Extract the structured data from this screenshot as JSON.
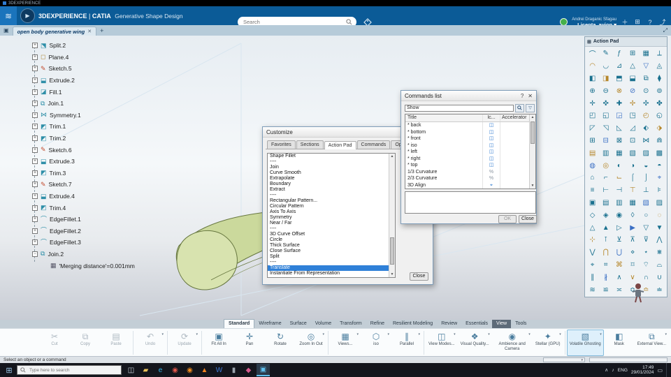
{
  "window": {
    "title": "3DEXPERIENCE"
  },
  "glyphs": {
    "close": "✕",
    "help": "?",
    "plus": "＋",
    "caret": "▾",
    "maximize": "⤢",
    "grid": "⊞",
    "share": "⤴",
    "window": "▣",
    "logo": "≋",
    "play": "▶",
    "new_tab": "+",
    "up": "▲",
    "down": "▼",
    "start": "⊞",
    "chevron": "∧",
    "volume": "♪",
    "funnel": "▽",
    "notif": "▭"
  },
  "header": {
    "brand": "3DEXPERIENCE",
    "divider": "|",
    "app": "CATIA",
    "workbench": "Generative Shape Design",
    "search_placeholder": "Search",
    "user_line1": "Andrei Draganic Sfagau",
    "user_line2": "Licenta_avion"
  },
  "tabbar": {
    "tab": "open body generative wing"
  },
  "tree": {
    "items": [
      {
        "label": "Split.2",
        "glyph": "⬔",
        "color": "#2e8fa8",
        "expand": "+"
      },
      {
        "label": "Plane.4",
        "glyph": "◻",
        "color": "#b08a3e",
        "expand": "+"
      },
      {
        "label": "Sketch.5",
        "glyph": "✎",
        "color": "#c24b2e",
        "expand": "+"
      },
      {
        "label": "Extrude.2",
        "glyph": "⬓",
        "color": "#2e8fa8",
        "expand": "+"
      },
      {
        "label": "Fill.1",
        "glyph": "◪",
        "color": "#2e8fa8",
        "expand": "+"
      },
      {
        "label": "Join.1",
        "glyph": "⧉",
        "color": "#2e8fa8",
        "expand": "+"
      },
      {
        "label": "Symmetry.1",
        "glyph": "⋈",
        "color": "#2e8fa8",
        "expand": "+"
      },
      {
        "label": "Trim.1",
        "glyph": "◩",
        "color": "#2e8fa8",
        "expand": "+"
      },
      {
        "label": "Trim.2",
        "glyph": "◩",
        "color": "#2e8fa8",
        "expand": "+"
      },
      {
        "label": "Sketch.6",
        "glyph": "✎",
        "color": "#c24b2e",
        "expand": "+"
      },
      {
        "label": "Extrude.3",
        "glyph": "⬓",
        "color": "#2e8fa8",
        "expand": "+"
      },
      {
        "label": "Trim.3",
        "glyph": "◩",
        "color": "#2e8fa8",
        "expand": "+"
      },
      {
        "label": "Sketch.7",
        "glyph": "✎",
        "color": "#c24b2e",
        "expand": "+"
      },
      {
        "label": "Extrude.4",
        "glyph": "⬓",
        "color": "#2e8fa8",
        "expand": "+"
      },
      {
        "label": "Trim.4",
        "glyph": "◩",
        "color": "#2e8fa8",
        "expand": "+"
      },
      {
        "label": "EdgeFillet.1",
        "glyph": "⌒",
        "color": "#2e8fa8",
        "expand": "+"
      },
      {
        "label": "EdgeFillet.2",
        "glyph": "⌒",
        "color": "#2e8fa8",
        "expand": "+"
      },
      {
        "label": "EdgeFillet.3",
        "glyph": "⌒",
        "color": "#2e8fa8",
        "expand": "+"
      },
      {
        "label": "Join.2",
        "glyph": "⧉",
        "color": "#2e8fa8",
        "expand": "−"
      }
    ],
    "child": {
      "label": "'Merging distance'=0.001mm",
      "glyph": "▦",
      "color": "#556"
    }
  },
  "action_pad": {
    "title": "Action Pad",
    "rows": [
      "⌒✎ƒ⊞▦⟂",
      "◠◡⊿△▽◬",
      "◧◨⬒⬓⧉⧫",
      "⊕⊖⊗⊘⊙⊚",
      "✛✜✚✢✣✤",
      "◰◱◲◳◴◵",
      "◸◹◺◿⬖⬗",
      "⊞⊟⊠⊡⋈⋒",
      "▤▥▦▧▨▩",
      "◍◎◐◑◒◓",
      "⌂⌐⌙⌠⌡⌖",
      "≡⊢⊣⊤⊥⊧",
      "▣▤▥▦▧▨",
      "◇◈◉◊○◌",
      "△▲▷▶▽▼",
      "⊹⊺⊻⊼⊽⋀",
      "⋁⋂⋃⋄⋆⋇",
      "⌖⌗⌘⌑⌔⌓",
      "∥∦∧∨∩∪",
      "≋≌≍≎≏≐"
    ]
  },
  "customize_dialog": {
    "title": "Customize",
    "tabs": [
      "Favorites",
      "Sections",
      "Action Pad",
      "Commands",
      "Options"
    ],
    "active_tab": "Action Pad",
    "items": [
      "Shape Fillet",
      "----",
      "Join",
      "Curve Smooth",
      "Extrapolate",
      "Boundary",
      "Extract",
      "----",
      "Rectangular Pattern...",
      "Circular Pattern",
      "Axis To Axis",
      "Symmetry",
      "Near / Far",
      "----",
      "3D Curve Offset",
      "Circle",
      "Thick Surface",
      "Close Surface",
      "Split",
      "----",
      "Translate",
      "Instantiate From Representation"
    ],
    "selected_index": 20,
    "close_label": "Close"
  },
  "commands_dialog": {
    "title": "Commands list",
    "filter_value": "Show",
    "headers": [
      "Title",
      "Ic...",
      "Accelerator"
    ],
    "rows": [
      {
        "title": "* back",
        "icon": "◫",
        "color": "#2f7bd0",
        "accelerator": ""
      },
      {
        "title": "* bottom",
        "icon": "◫",
        "color": "#2f7bd0",
        "accelerator": ""
      },
      {
        "title": "* front",
        "icon": "◫",
        "color": "#2f7bd0",
        "accelerator": ""
      },
      {
        "title": "* iso",
        "icon": "◫",
        "color": "#2f7bd0",
        "accelerator": ""
      },
      {
        "title": "* left",
        "icon": "◫",
        "color": "#2f7bd0",
        "accelerator": ""
      },
      {
        "title": "* right",
        "icon": "◫",
        "color": "#2f7bd0",
        "accelerator": ""
      },
      {
        "title": "* top",
        "icon": "◫",
        "color": "#2f7bd0",
        "accelerator": ""
      },
      {
        "title": "1/3 Curvature",
        "icon": "%",
        "color": "#8a94a0",
        "accelerator": ""
      },
      {
        "title": "2/3 Curvature",
        "icon": "%",
        "color": "#8a94a0",
        "accelerator": ""
      },
      {
        "title": "3D Align",
        "icon": "⌖",
        "color": "#2f7bd0",
        "accelerator": ""
      }
    ],
    "ok_label": "OK",
    "close_label": "Close"
  },
  "ribbon": {
    "tabs": [
      {
        "label": "Standard",
        "state": "active"
      },
      {
        "label": "Wireframe",
        "state": "normal"
      },
      {
        "label": "Surface",
        "state": "normal"
      },
      {
        "label": "Volume",
        "state": "normal"
      },
      {
        "label": "Transform",
        "state": "normal"
      },
      {
        "label": "Refine",
        "state": "normal"
      },
      {
        "label": "Resilient Modeling",
        "state": "normal"
      },
      {
        "label": "Review",
        "state": "normal"
      },
      {
        "label": "Essentials",
        "state": "normal"
      },
      {
        "label": "View",
        "state": "selected"
      },
      {
        "label": "Tools",
        "state": "normal"
      }
    ],
    "tools": [
      {
        "label": "Cut",
        "glyph": "✂",
        "disabled": true
      },
      {
        "label": "Copy",
        "glyph": "⧉",
        "disabled": true
      },
      {
        "label": "Paste",
        "glyph": "▤",
        "disabled": true
      },
      {
        "label": "Undo",
        "glyph": "↶",
        "arrow": true,
        "disabled": true,
        "sep": true
      },
      {
        "label": "Update",
        "glyph": "⟳",
        "arrow": true,
        "disabled": true,
        "sep": true
      },
      {
        "label": "Fit All In",
        "glyph": "▣",
        "sep": true
      },
      {
        "label": "Pan",
        "glyph": "✛"
      },
      {
        "label": "Rotate",
        "glyph": "↻"
      },
      {
        "label": "Zoom In Out",
        "glyph": "◎",
        "arrow": true
      },
      {
        "label": "Views...",
        "glyph": "▦",
        "arrow": true,
        "sep": true
      },
      {
        "label": "iso",
        "glyph": "⬡",
        "arrow": true
      },
      {
        "label": "Parallel",
        "glyph": "∥",
        "arrow": true
      },
      {
        "label": "View Modes...",
        "glyph": "◫",
        "arrow": true,
        "sep": true
      },
      {
        "label": "Visual Quality...",
        "glyph": "❖",
        "arrow": true
      },
      {
        "label": "Ambience and Camera",
        "glyph": "◉",
        "arrow": true
      },
      {
        "label": "Stellar (GPU)",
        "glyph": "✦",
        "arrow": true
      },
      {
        "label": "Volatile Ghosting",
        "glyph": "▧",
        "arrow": true,
        "active": true,
        "sep": true
      },
      {
        "label": "Mask",
        "glyph": "◧"
      },
      {
        "label": "External View...",
        "glyph": "⧉",
        "arrow": true
      }
    ]
  },
  "statusbar": {
    "message": "Select an object or a command"
  },
  "taskbar": {
    "search_placeholder": "Type here to search",
    "apps": [
      {
        "name": "task-view-icon",
        "glyph": "◫",
        "color": "#cfd8e0"
      },
      {
        "name": "file-explorer-icon",
        "glyph": "▰",
        "color": "#eac25a"
      },
      {
        "name": "edge-icon",
        "glyph": "e",
        "color": "#35b2e5"
      },
      {
        "name": "chrome-icon",
        "glyph": "◉",
        "color": "#e2564a"
      },
      {
        "name": "firefox-icon",
        "glyph": "◉",
        "color": "#f08c1e"
      },
      {
        "name": "media-player-icon",
        "glyph": "▲",
        "color": "#f0821e"
      },
      {
        "name": "word-icon",
        "glyph": "W",
        "color": "#3f7ad6"
      },
      {
        "name": "terminal-icon",
        "glyph": "▮",
        "color": "#9aa4ad"
      },
      {
        "name": "paint-icon",
        "glyph": "◆",
        "color": "#d65a8e"
      },
      {
        "name": "catia-icon",
        "glyph": "▣",
        "color": "#5ec1f0",
        "active": true
      }
    ],
    "lang": "ENG",
    "time": "17:49",
    "date": "29/01/2024"
  }
}
